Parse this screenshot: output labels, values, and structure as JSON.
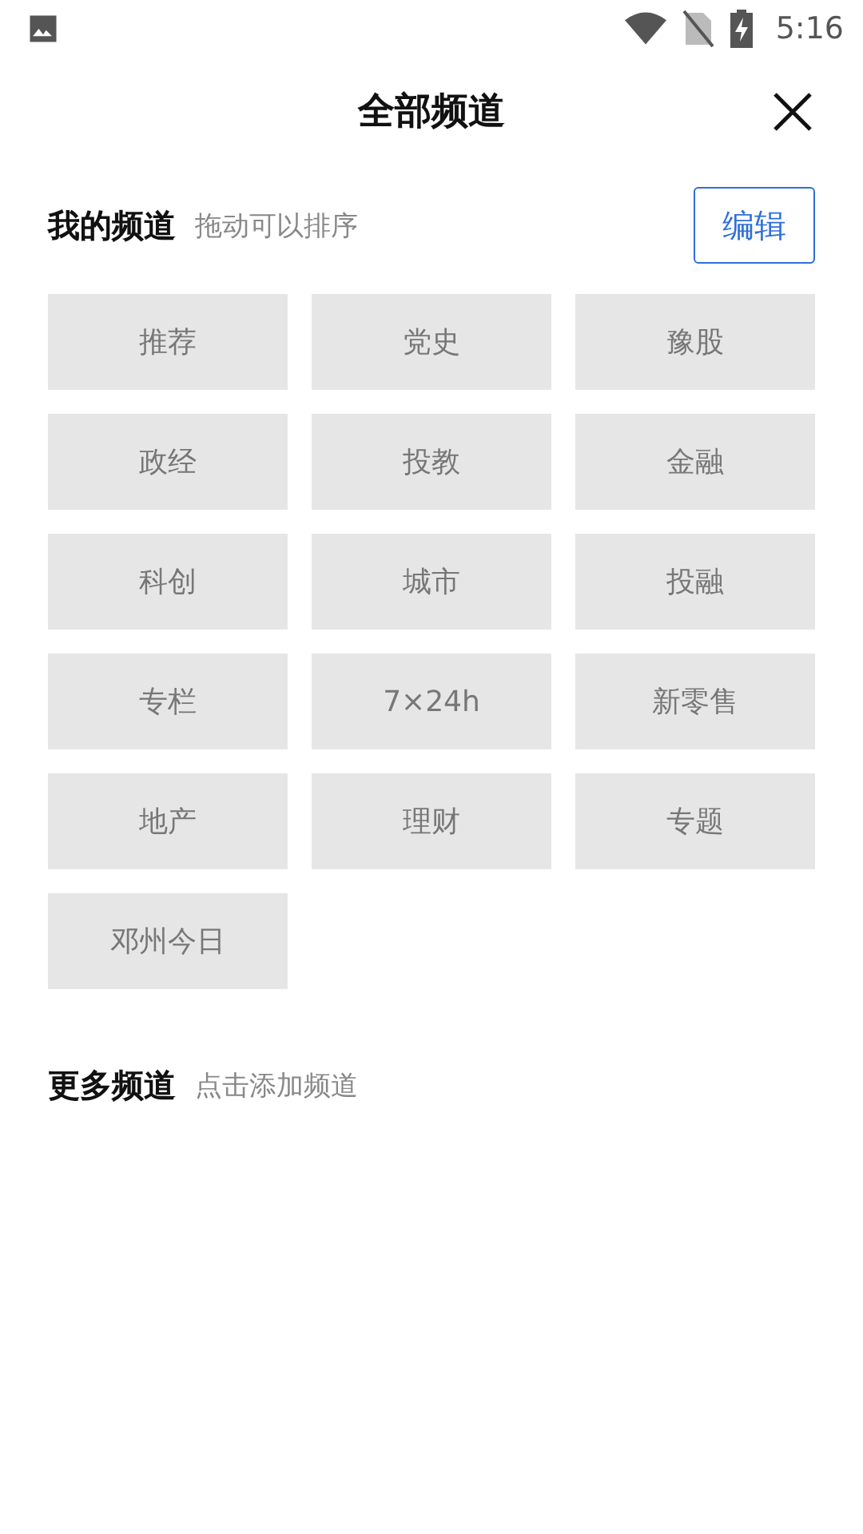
{
  "status_bar": {
    "time": "5:16"
  },
  "header": {
    "title": "全部频道"
  },
  "my_channels": {
    "title": "我的频道",
    "hint": "拖动可以排序",
    "edit_button": "编辑",
    "items": [
      "推荐",
      "党史",
      "豫股",
      "政经",
      "投教",
      "金融",
      "科创",
      "城市",
      "投融",
      "专栏",
      "7×24h",
      "新零售",
      "地产",
      "理财",
      "专题",
      "邓州今日"
    ]
  },
  "more_channels": {
    "title": "更多频道",
    "hint": "点击添加频道"
  }
}
